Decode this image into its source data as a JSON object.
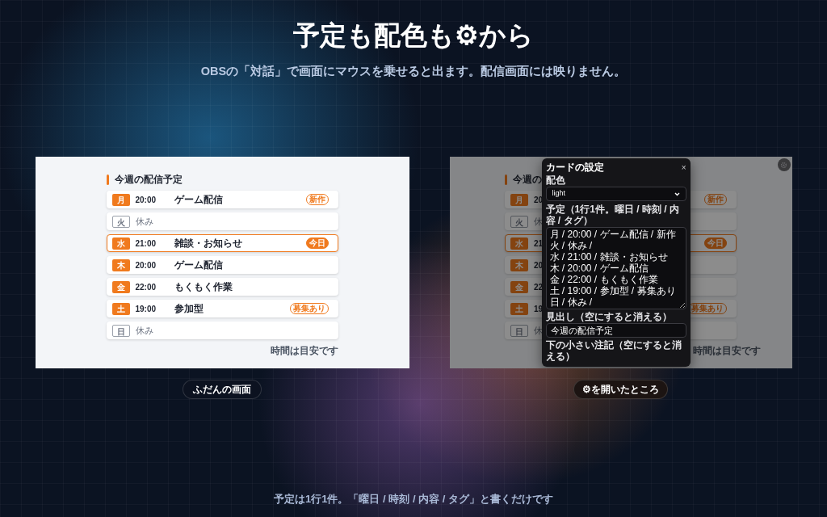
{
  "header": {
    "title": "予定も配色も⚙から",
    "subtitle": "OBSの「対話」で画面にマウスを乗せると出ます。配信画面には映りません。"
  },
  "normal_view": {
    "caption": "ふだんの画面",
    "card": {
      "heading": "今週の配信予定",
      "footer": "時間は目安です",
      "rows": [
        {
          "kind": "event",
          "day": "月",
          "time": "20:00",
          "title": "ゲーム配信",
          "tag": "新作",
          "today": false
        },
        {
          "kind": "off",
          "day": "火",
          "title": "休み",
          "today": false
        },
        {
          "kind": "event",
          "day": "水",
          "time": "21:00",
          "title": "雑談・お知らせ",
          "tag": "今日",
          "today": true
        },
        {
          "kind": "event",
          "day": "木",
          "time": "20:00",
          "title": "ゲーム配信",
          "today": false
        },
        {
          "kind": "event",
          "day": "金",
          "time": "22:00",
          "title": "もくもく作業",
          "today": false
        },
        {
          "kind": "event",
          "day": "土",
          "time": "19:00",
          "title": "参加型",
          "tag": "募集あり",
          "today": false
        },
        {
          "kind": "off",
          "day": "日",
          "title": "休み",
          "today": false
        }
      ]
    }
  },
  "settings_view": {
    "caption": "⚙を開いたところ",
    "card": {
      "heading": "今週の",
      "footer": "時間は目安です",
      "rows": [
        {
          "kind": "event",
          "day": "月",
          "time": "20",
          "tag": "新作",
          "today": false
        },
        {
          "kind": "off",
          "day": "火",
          "title": "休",
          "today": false
        },
        {
          "kind": "event",
          "day": "水",
          "time": "21",
          "tag": "今日",
          "today": true
        },
        {
          "kind": "event",
          "day": "木",
          "time": "20",
          "today": false
        },
        {
          "kind": "event",
          "day": "金",
          "time": "22",
          "today": false
        },
        {
          "kind": "event",
          "day": "土",
          "time": "19",
          "tag": "募集あり",
          "today": false
        },
        {
          "kind": "off",
          "day": "日",
          "title": "休",
          "today": false
        }
      ]
    },
    "dialog": {
      "title": "カードの設定",
      "close": "×",
      "theme_label": "配色",
      "theme_value": "light",
      "schedule_label": "予定（1行1件。曜日 / 時刻 / 内容 / タグ）",
      "schedule_lines": [
        "月 / 20:00 / ゲーム配信 / 新作",
        "火 / 休み /",
        "水 / 21:00 / 雑談・お知らせ",
        "木 / 20:00 / ゲーム配信",
        "金 / 22:00 / もくもく作業",
        "土 / 19:00 / 参加型 / 募集あり",
        "日 / 休み /"
      ],
      "heading_label": "見出し（空にすると消える）",
      "heading_value": "今週の配信予定",
      "note_label": "下の小さい注記（空にすると消える）"
    }
  },
  "footer": "予定は1行1件。「曜日 / 時刻 / 内容 / タグ」と書くだけです"
}
